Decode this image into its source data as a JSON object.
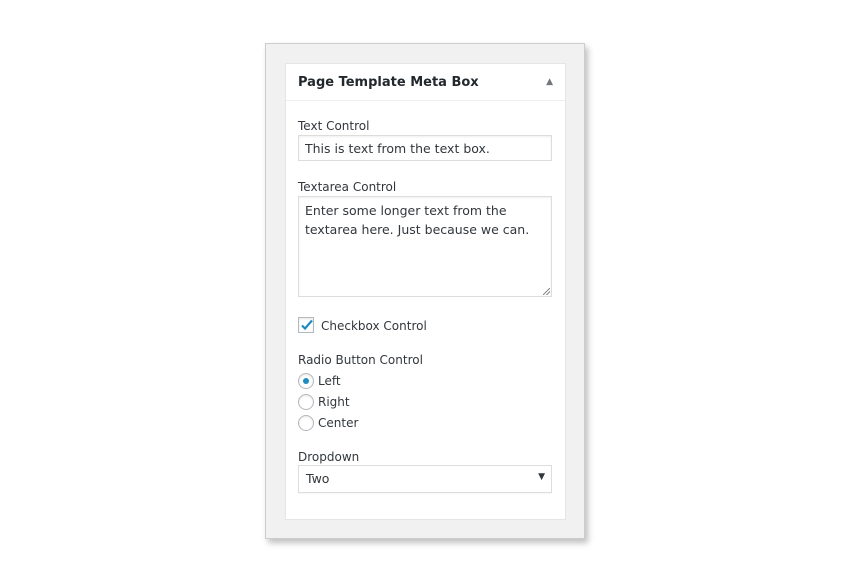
{
  "metabox": {
    "title": "Page Template Meta Box",
    "toggle_icon": "triangle-up-icon",
    "text_control": {
      "label": "Text Control",
      "value": "This is text from the text box."
    },
    "textarea_control": {
      "label": "Textarea Control",
      "value": "Enter some longer text from the textarea here. Just because we can."
    },
    "checkbox_control": {
      "label": "Checkbox Control",
      "checked": true
    },
    "radio_control": {
      "label": "Radio Button Control",
      "options": [
        "Left",
        "Right",
        "Center"
      ],
      "selected": "Left"
    },
    "dropdown": {
      "label": "Dropdown",
      "selected": "Two"
    },
    "accent_color": "#1e8cbe"
  }
}
